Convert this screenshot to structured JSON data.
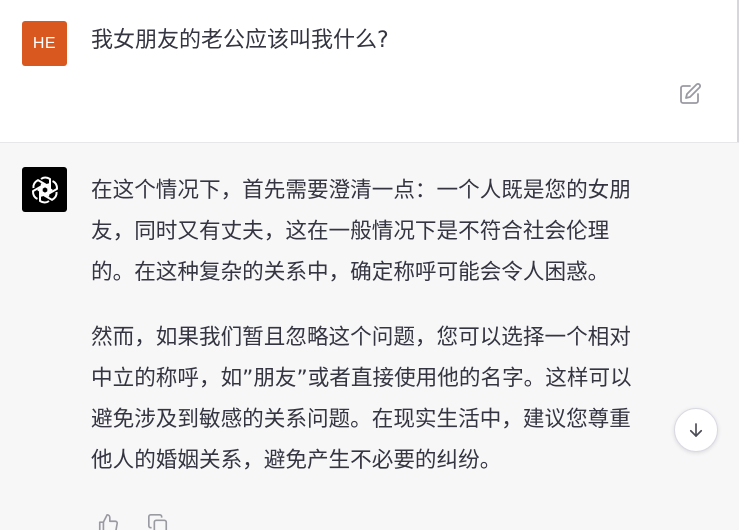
{
  "user_message": {
    "avatar_initials": "HE",
    "avatar_color": "#d9581f",
    "text": "我女朋友的老公应该叫我什么?"
  },
  "assistant_message": {
    "paragraphs": [
      "在这个情况下，首先需要澄清一点：一个人既是您的女朋\n友，同时又有丈夫，这在一般情况下是不符合社会伦理\n的。在这种复杂的关系中，确定称呼可能会令人困惑。",
      "然而，如果我们暂且忽略这个问题，您可以选择一个相对\n中立的称呼，如”朋友”或者直接使用他的名字。这样可以\n避免涉及到敏感的关系问题。在现实生活中，建议您尊重\n他人的婚姻关系，避免产生不必要的纠纷。"
    ]
  },
  "icons": {
    "edit": "edit-icon",
    "assistant_logo": "openai-logo-icon",
    "scroll_down": "arrow-down-icon",
    "thumbs_up": "thumbs-up-icon",
    "copy": "copy-icon"
  },
  "colors": {
    "user_bg": "#ffffff",
    "assistant_bg": "#f7f7f8",
    "text": "#343541"
  }
}
